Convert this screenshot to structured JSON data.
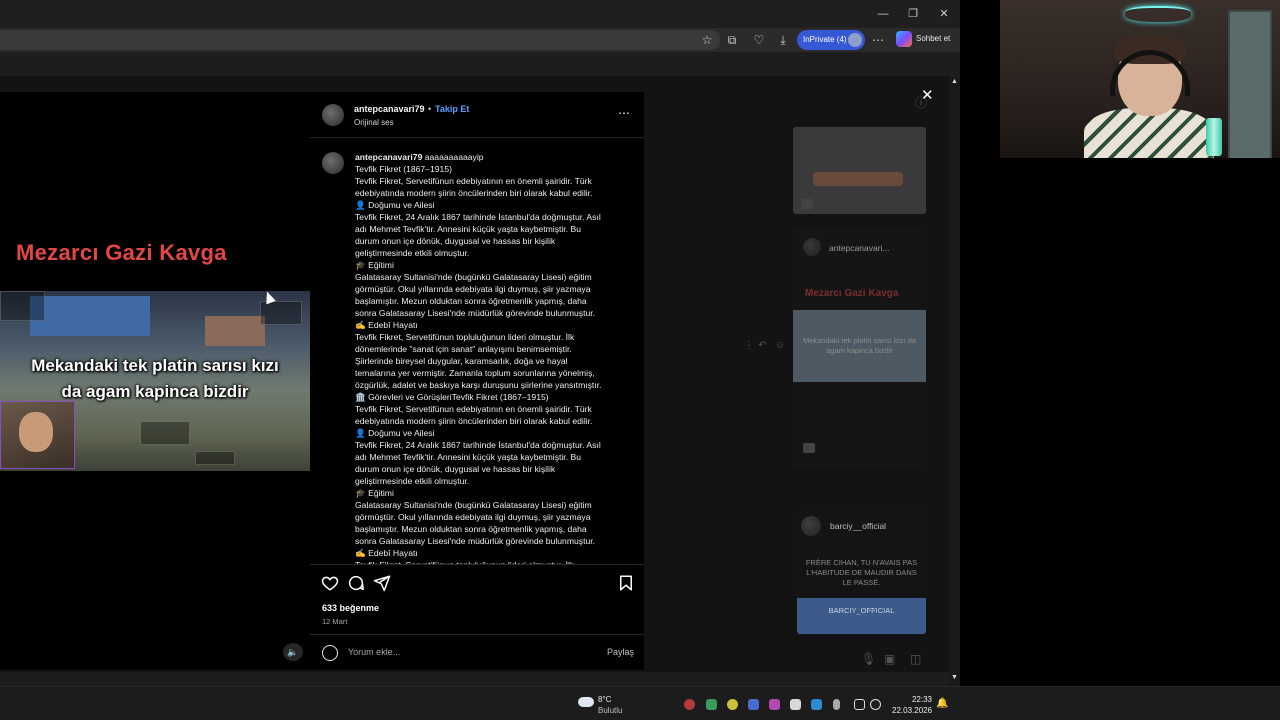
{
  "browser": {
    "inprivate_label": "InPrivate (4)",
    "copilot_label": "Sohbet et",
    "icons": [
      "favorite-star-icon",
      "extensions-icon",
      "browser-essentials-icon",
      "downloads-icon",
      "more-menu-icon"
    ]
  },
  "video": {
    "title": "Mezarcı Gazi Kavga",
    "caption_line1": "Mekandaki tek platin sarısı kızı",
    "caption_line2": "da agam kapinca bizdir"
  },
  "post": {
    "username": "antepcanavari79",
    "separator": "•",
    "follow_label": "Takip Et",
    "audio": "Orijinal ses",
    "caption_username": "antepcanavari79",
    "caption_first": "aaaaaaaaaayip",
    "caption_lines": [
      {
        "t": "Tevfik Fikret (1867–1915)"
      },
      {
        "t": "Tevfik Fikret, Servetifünun edebiyatının en önemli şairidir. Türk"
      },
      {
        "t": "edebiyatında modern şiirin öncülerinden biri olarak kabul edilir."
      },
      {
        "t": "👤 Doğumu ve Ailesi"
      },
      {
        "t": "Tevfik Fikret, 24 Aralık 1867 tarihinde İstanbul'da doğmuştur. Asıl"
      },
      {
        "t": "adı Mehmet Tevfik'tir. Annesini küçük yaşta kaybetmiştir. Bu"
      },
      {
        "t": "durum onun içe dönük, duygusal ve hassas bir kişilik"
      },
      {
        "t": "geliştirmesinde etkili olmuştur."
      },
      {
        "t": "🎓 Eğitimi"
      },
      {
        "t": "Galatasaray Sultanisi'nde (bugünkü Galatasaray Lisesi) eğitim"
      },
      {
        "t": "görmüştür. Okul yıllarında edebiyata ilgi duymuş, şiir yazmaya"
      },
      {
        "t": "başlamıştır. Mezun olduktan sonra öğretmenlik yapmış, daha"
      },
      {
        "t": "sonra Galatasaray Lisesi'nde müdürlük görevinde bulunmuştur."
      },
      {
        "t": "✍️ Edebî Hayatı"
      },
      {
        "t": "Tevfik Fikret, Servetifünun topluluğunun lideri olmuştur. İlk"
      },
      {
        "t": "dönemlerinde \"sanat için sanat\" anlayışını benimsemiştir."
      },
      {
        "t": "Şiirlerinde bireysel duygular, karamsarlık, doğa ve hayal"
      },
      {
        "t": "temalarına yer vermiştir. Zamanla toplum sorunlarına yönelmiş,"
      },
      {
        "t": "özgürlük, adalet ve baskıya karşı duruşunu şiirlerine yansıtmıştır."
      },
      {
        "t": "🏛️ Görevleri ve GörüşleriTevfik Fikret (1867–1915)"
      },
      {
        "t": "Tevfik Fikret, Servetifünun edebiyatının en önemli şairidir. Türk"
      },
      {
        "t": "edebiyatında modern şiirin öncülerinden biri olarak kabul edilir."
      },
      {
        "t": "👤 Doğumu ve Ailesi"
      },
      {
        "t": "Tevfik Fikret, 24 Aralık 1867 tarihinde İstanbul'da doğmuştur. Asıl"
      },
      {
        "t": "adı Mehmet Tevfik'tir. Annesini küçük yaşta kaybetmiştir. Bu"
      },
      {
        "t": "durum onun içe dönük, duygusal ve hassas bir kişilik"
      },
      {
        "t": "geliştirmesinde etkili olmuştur."
      },
      {
        "t": "🎓 Eğitimi"
      },
      {
        "t": "Galatasaray Sultanisi'nde (bugünkü Galatasaray Lisesi) eğitim"
      },
      {
        "t": "görmüştür. Okul yıllarında edebiyata ilgi duymuş, şiir yazmaya"
      },
      {
        "t": "başlamıştır. Mezun olduktan sonra öğretmenlik yapmış, daha"
      },
      {
        "t": "sonra Galatasaray Lisesi'nde müdürlük görevinde bulunmuştur."
      },
      {
        "t": "✍️ Edebî Hayatı"
      },
      {
        "t": "Tevfik Fikret, Servetifünun topluluğunun lideri olmuştur. İlk"
      }
    ],
    "likes": "633 beğenme",
    "date": "12 Mart",
    "comment_placeholder": "Yorum ekle...",
    "share_label": "Paylaş"
  },
  "background": {
    "reel_user": "antepcanavari...",
    "reel_title": "Mezarcı Gazi Kavga",
    "reel_caption": "Mekandaki tek platin sarısı kızı da agam kapinca bizdir",
    "other_user": "barciy__official",
    "other_caption": "FRÈRE CIHAN, TU N'AVAIS PAS L'HABITUDE DE MAUDIR DANS LE PASSÉ.",
    "other_label": "BARCIY_OFFICIAL"
  },
  "taskbar": {
    "temperature": "8°C",
    "weather": "Bulutlu",
    "time": "22:33",
    "date": "22.03.2026"
  }
}
